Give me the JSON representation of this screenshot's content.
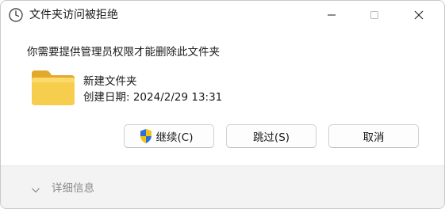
{
  "window": {
    "title": "文件夹访问被拒绝",
    "minimize_icon": "minimize-icon",
    "maximize_icon": "maximize-icon",
    "close_icon": "close-icon",
    "app_icon": "clock-icon"
  },
  "content": {
    "message": "你需要提供管理员权限才能删除此文件夹",
    "item": {
      "icon": "folder-icon",
      "name": "新建文件夹",
      "created": "创建日期: 2024/2/29 13:31"
    }
  },
  "buttons": {
    "continue_label": "继续(C)",
    "continue_icon": "uac-shield-icon",
    "skip_label": "跳过(S)",
    "cancel_label": "取消"
  },
  "footer": {
    "details_label": "详细信息",
    "details_icon": "chevron-down-icon"
  },
  "colors": {
    "folder": "#f5c542",
    "folder_dark": "#e3a92b",
    "shield_blue": "#2f6fd8",
    "shield_yellow": "#f2c40f",
    "footer_bg": "#f3f3f3"
  }
}
